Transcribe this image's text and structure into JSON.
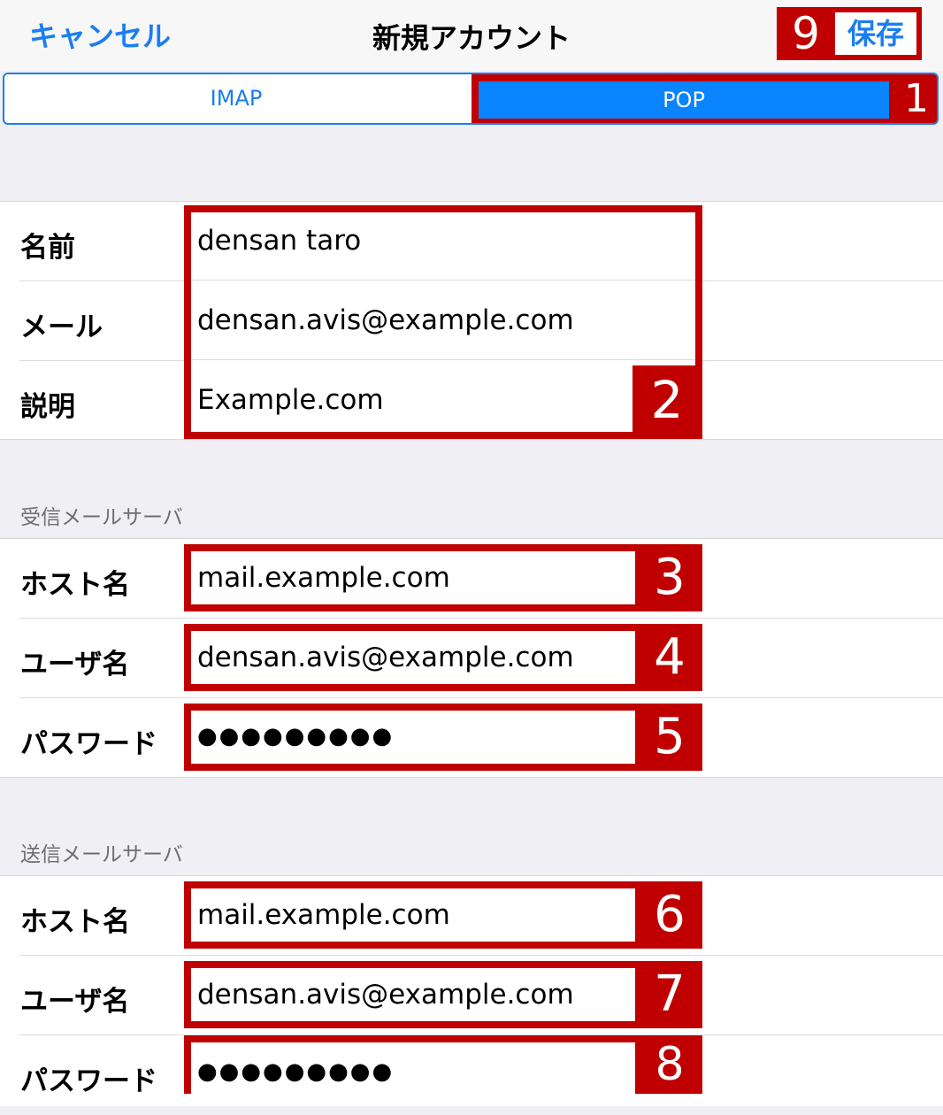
{
  "nav": {
    "cancel_label": "キャンセル",
    "title": "新規アカウント",
    "save_label": "保存",
    "save_badge": "9"
  },
  "segment": {
    "imap_label": "IMAP",
    "pop_label": "POP",
    "pop_badge": "1"
  },
  "account": {
    "name_label": "名前",
    "name_value": "densan taro",
    "email_label": "メール",
    "email_value": "densan.avis@example.com",
    "desc_label": "説明",
    "desc_value": "Example.com",
    "badge": "2"
  },
  "incoming": {
    "header": "受信メールサーバ",
    "host_label": "ホスト名",
    "host_value": "mail.example.com",
    "host_badge": "3",
    "user_label": "ユーザ名",
    "user_value": "densan.avis@example.com",
    "user_badge": "4",
    "password_label": "パスワード",
    "password_value": "●●●●●●●●●",
    "password_badge": "5"
  },
  "outgoing": {
    "header": "送信メールサーバ",
    "host_label": "ホスト名",
    "host_value": "mail.example.com",
    "host_badge": "6",
    "user_label": "ユーザ名",
    "user_value": "densan.avis@example.com",
    "user_badge": "7",
    "password_label": "パスワード",
    "password_value": "●●●●●●●●●",
    "password_badge": "8"
  },
  "colors": {
    "accent": "#1a7ef0",
    "selected_segment": "#0a84ff",
    "highlight": "#c00000",
    "background": "#efeff4"
  }
}
